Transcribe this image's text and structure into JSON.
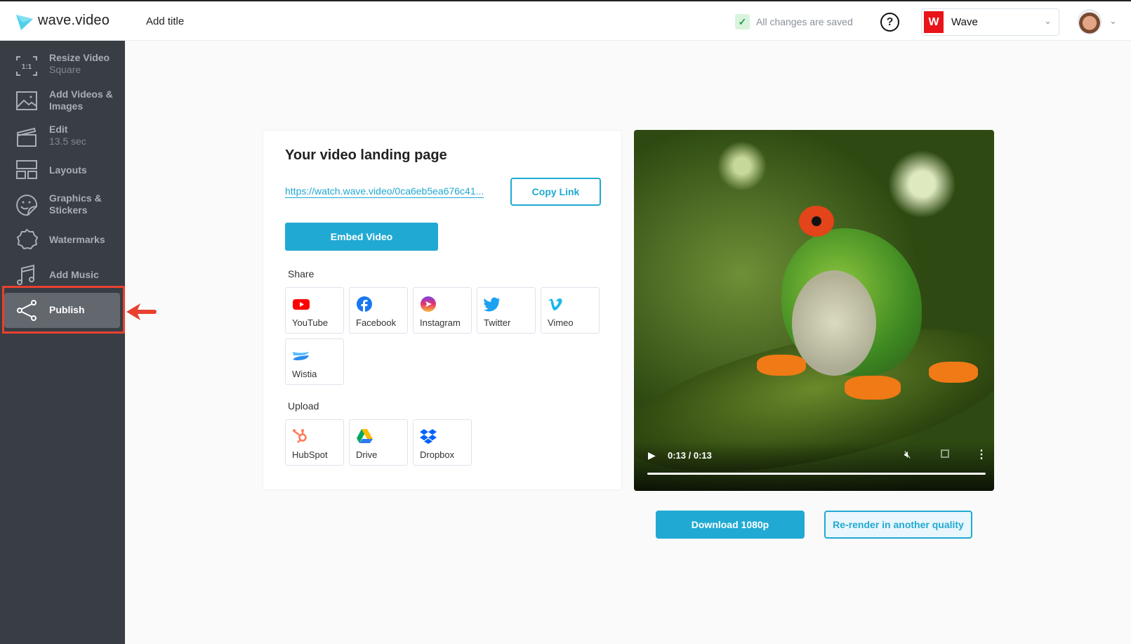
{
  "header": {
    "brand": "wave.video",
    "title": "Add title",
    "save_status": "All changes are saved",
    "help": "?",
    "workspace": {
      "initial": "W",
      "name": "Wave",
      "color": "#e8141a"
    }
  },
  "sidebar": {
    "items": [
      {
        "label": "Resize Video",
        "sub": "Square",
        "icon": "resize-icon",
        "glyph": "1:1"
      },
      {
        "label": "Add Videos & Images",
        "icon": "image-icon"
      },
      {
        "label": "Edit",
        "sub": "13.5 sec",
        "icon": "clapperboard-icon"
      },
      {
        "label": "Layouts",
        "icon": "layout-icon"
      },
      {
        "label": "Graphics & Stickers",
        "icon": "sticker-icon"
      },
      {
        "label": "Watermarks",
        "icon": "watermark-icon"
      },
      {
        "label": "Add Music",
        "icon": "music-icon"
      },
      {
        "label": "Publish",
        "icon": "share-icon",
        "active": true
      }
    ],
    "highlight_color": "#e8412f"
  },
  "card": {
    "title": "Your video landing page",
    "url": "https://watch.wave.video/0ca6eb5ea676c41...",
    "copy_label": "Copy Link",
    "embed_label": "Embed Video",
    "share_label": "Share",
    "share": [
      {
        "label": "YouTube",
        "icon": "youtube-icon"
      },
      {
        "label": "Facebook",
        "icon": "facebook-icon"
      },
      {
        "label": "Instagram",
        "icon": "instagram-icon"
      },
      {
        "label": "Twitter",
        "icon": "twitter-icon"
      },
      {
        "label": "Vimeo",
        "icon": "vimeo-icon"
      },
      {
        "label": "Wistia",
        "icon": "wistia-icon"
      }
    ],
    "upload_label": "Upload",
    "upload": [
      {
        "label": "HubSpot",
        "icon": "hubspot-icon"
      },
      {
        "label": "Drive",
        "icon": "google-drive-icon"
      },
      {
        "label": "Dropbox",
        "icon": "dropbox-icon"
      }
    ]
  },
  "player": {
    "time": "0:13 / 0:13",
    "progress_percent": 100,
    "muted": true
  },
  "actions": {
    "download": "Download 1080p",
    "rerender": "Re-render in another quality"
  },
  "accent_color": "#20aad3"
}
